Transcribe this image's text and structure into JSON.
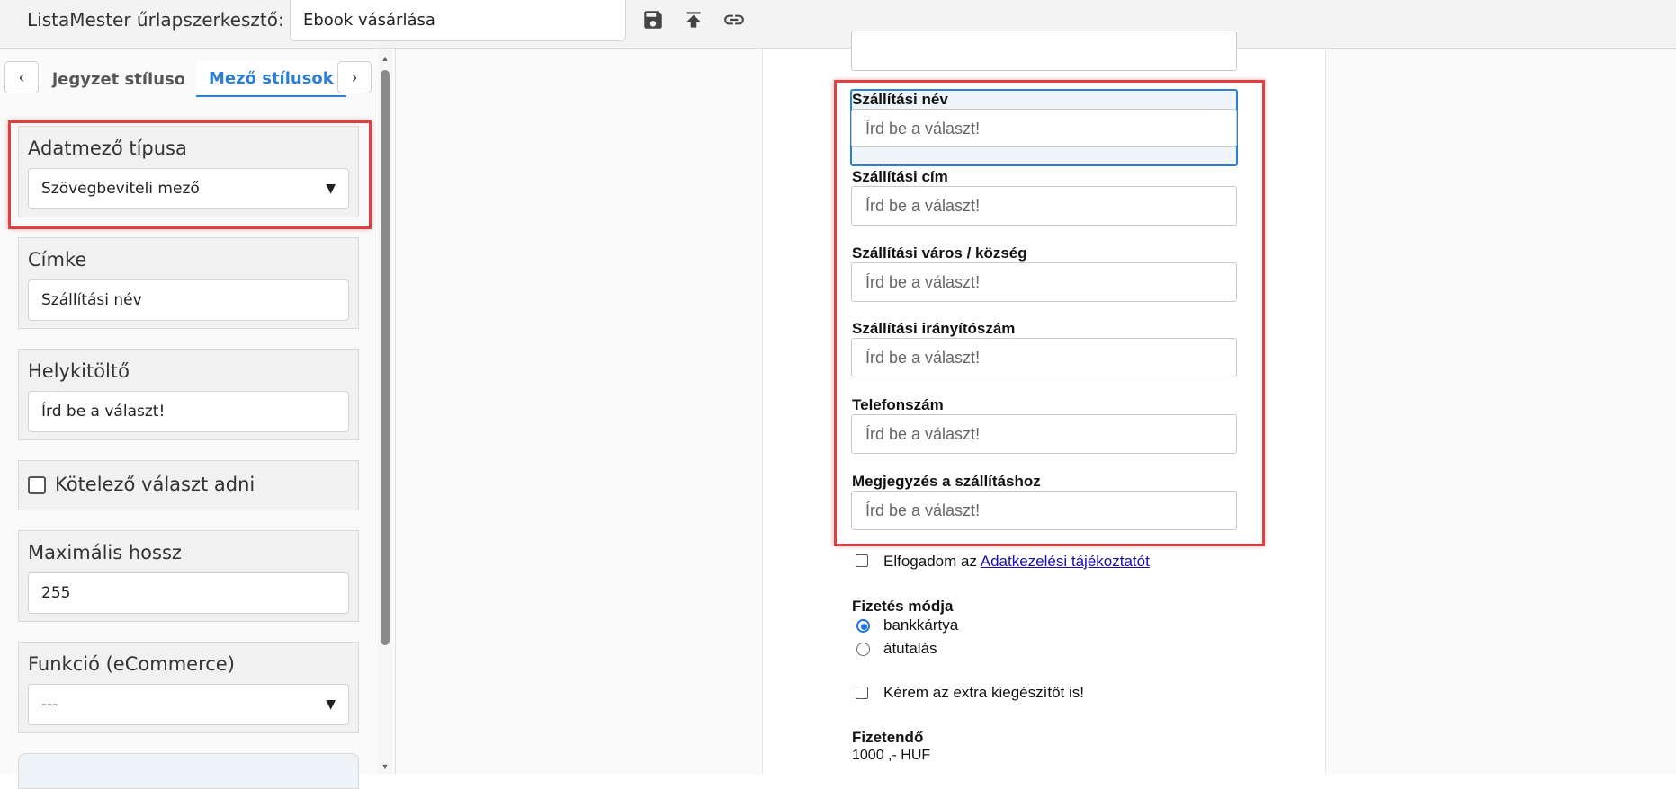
{
  "header": {
    "app_title": "ListaMester űrlapszerkesztő:",
    "form_name": "Ebook vásárlása",
    "icons": [
      "save-icon",
      "upload-icon",
      "link-icon"
    ]
  },
  "sidebar": {
    "prev_arrow": "‹",
    "next_arrow": "›",
    "tabs": [
      {
        "label": "jegyzet stílusok",
        "active": false
      },
      {
        "label": "Mező stílusok",
        "active": true
      }
    ],
    "field_type": {
      "label": "Adatmező típusa",
      "value": "Szövegbeviteli mező"
    },
    "label_field": {
      "label": "Címke",
      "value": "Szállítási név"
    },
    "placeholder_field": {
      "label": "Helykitöltő",
      "value": "Írd be a választ!"
    },
    "required": {
      "label": "Kötelező választ adni",
      "checked": false
    },
    "max_length": {
      "label": "Maximális hossz",
      "value": "255"
    },
    "function": {
      "label": "Funkció (eCommerce)",
      "value": "---"
    }
  },
  "form": {
    "fields": [
      {
        "label": "Szállítási név",
        "placeholder": "Írd be a választ!"
      },
      {
        "label": "Szállítási cím",
        "placeholder": "Írd be a választ!"
      },
      {
        "label": "Szállítási város / község",
        "placeholder": "Írd be a választ!"
      },
      {
        "label": "Szállítási irányítószám",
        "placeholder": "Írd be a választ!"
      },
      {
        "label": "Telefonszám",
        "placeholder": "Írd be a választ!"
      },
      {
        "label": "Megjegyzés a szállításhoz",
        "placeholder": "Írd be a választ!"
      }
    ],
    "accept_prefix": "Elfogadom az",
    "accept_link": "Adatkezelési tájékoztatót",
    "payment": {
      "label": "Fizetés módja",
      "options": [
        {
          "label": "bankkártya",
          "selected": true
        },
        {
          "label": "átutalás",
          "selected": false
        }
      ]
    },
    "extra": "Kérem az extra kiegészítőt is!",
    "total_label": "Fizetendő",
    "total_value": "1000 ,- HUF"
  },
  "colors": {
    "accent": "#2d7fd6",
    "highlight": "#e04040"
  }
}
